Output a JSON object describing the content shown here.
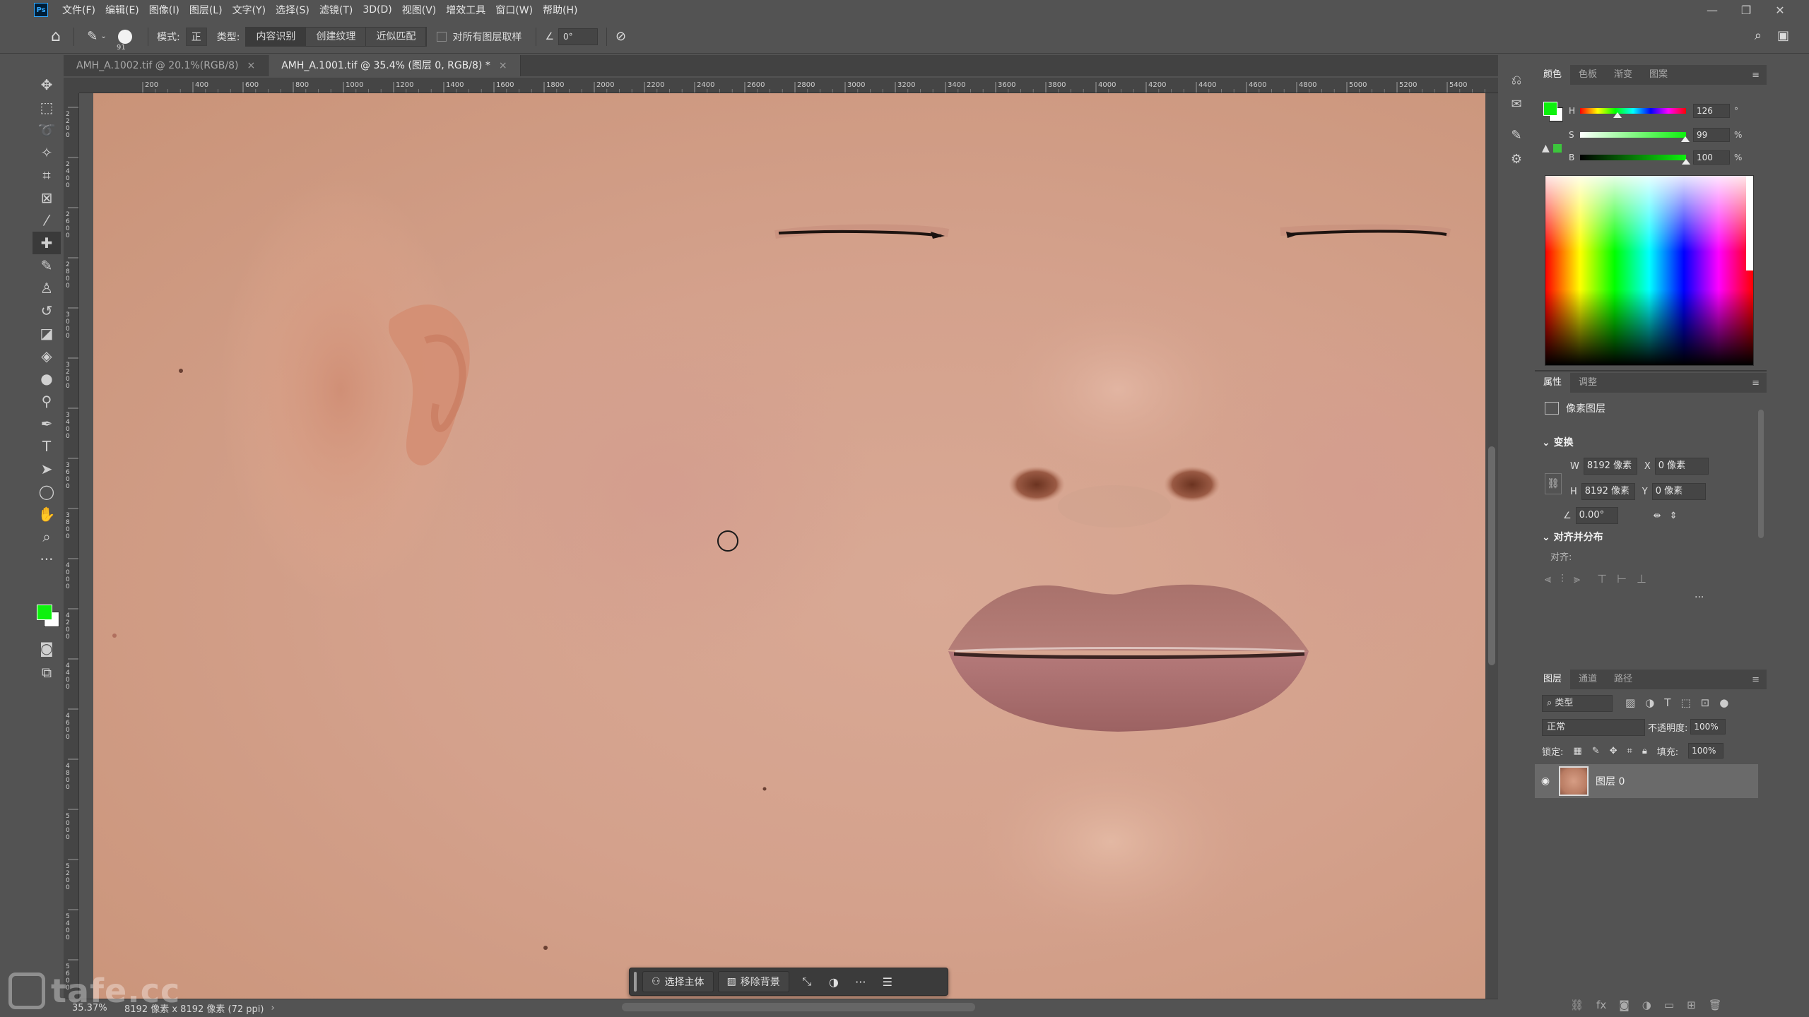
{
  "app": {
    "logo": "Ps",
    "menu": [
      "文件(F)",
      "编辑(E)",
      "图像(I)",
      "图层(L)",
      "文字(Y)",
      "选择(S)",
      "滤镜(T)",
      "3D(D)",
      "视图(V)",
      "增效工具",
      "窗口(W)",
      "帮助(H)"
    ],
    "window_controls": [
      "—",
      "❐",
      "✕"
    ]
  },
  "options_bar": {
    "brush_size": "91",
    "mode_label": "模式:",
    "mode_value": "正",
    "type_label": "类型:",
    "type_options": [
      "内容识别",
      "创建纹理",
      "近似匹配"
    ],
    "type_selected": "内容识别",
    "sample_all_layers": "对所有图层取样",
    "angle_value": "0°"
  },
  "tabs": [
    {
      "label": "AMH_A.1002.tif @ 20.1%(RGB/8)",
      "active": false
    },
    {
      "label": "AMH_A.1001.tif @ 35.4% (图层 0, RGB/8) *",
      "active": true
    }
  ],
  "ruler": {
    "h_ticks": [
      "200",
      "400",
      "600",
      "800",
      "1000",
      "1200",
      "1400",
      "1600",
      "1800",
      "2000",
      "2200",
      "2400",
      "2600",
      "2800",
      "3000",
      "3200",
      "3400",
      "3600",
      "3800",
      "4000",
      "4200",
      "4400",
      "4600",
      "4800",
      "5000",
      "5200",
      "5400"
    ],
    "v_ticks": [
      "2200",
      "2400",
      "2600",
      "2800",
      "3000",
      "3200",
      "3400",
      "3600",
      "3800",
      "4000",
      "4200",
      "4400",
      "4600",
      "4800",
      "5000",
      "5200",
      "5400",
      "5600"
    ]
  },
  "toolbar": {
    "tools": [
      "move-tool",
      "marquee-tool",
      "lasso-tool",
      "magic-wand-tool",
      "crop-tool",
      "frame-tool",
      "eyedropper-tool",
      "healing-brush-tool",
      "brush-tool",
      "clone-stamp-tool",
      "history-brush-tool",
      "eraser-tool",
      "paint-bucket-tool",
      "blur-tool",
      "dodge-tool",
      "pen-tool",
      "type-tool",
      "path-selection-tool",
      "ellipse-tool",
      "hand-tool",
      "zoom-tool",
      "more-tools"
    ],
    "active_tool": "healing-brush-tool",
    "foreground_color": "#0df10d",
    "background_color": "#ffffff"
  },
  "taskbar": {
    "select_subject": "选择主体",
    "remove_background": "移除背景"
  },
  "status": {
    "zoom": "35.37%",
    "info": "8192 像素 x 8192 像素 (72 ppi)",
    "arrow": "›"
  },
  "color_panel": {
    "tabs": [
      "颜色",
      "色板",
      "渐变",
      "图案"
    ],
    "active_tab": "颜色",
    "h": {
      "label": "H",
      "value": "126",
      "unit": "°",
      "fraction": 0.35
    },
    "s": {
      "label": "S",
      "value": "99",
      "unit": "%",
      "fraction": 0.99
    },
    "b": {
      "label": "B",
      "value": "100",
      "unit": "%",
      "fraction": 1.0
    }
  },
  "properties_panel": {
    "tabs": [
      "属性",
      "调整"
    ],
    "active_tab": "属性",
    "layer_type": "像素图层",
    "transform_title": "变换",
    "w_label": "W",
    "w_value": "8192 像素",
    "h_label": "H",
    "h_value": "8192 像素",
    "x_label": "X",
    "x_value": "0 像素",
    "y_label": "Y",
    "y_value": "0 像素",
    "angle_value": "0.00°",
    "align_title": "对齐并分布",
    "align_label": "对齐:",
    "more": "···"
  },
  "layers_panel": {
    "tabs": [
      "图层",
      "通道",
      "路径"
    ],
    "active_tab": "图层",
    "search_placeholder": "类型",
    "blend_mode": "正常",
    "opacity_label": "不透明度:",
    "opacity_value": "100%",
    "lock_label": "锁定:",
    "fill_label": "填充:",
    "fill_value": "100%",
    "layers": [
      {
        "name": "图层 0",
        "visible": true
      }
    ]
  },
  "watermark": "tafe.cc"
}
